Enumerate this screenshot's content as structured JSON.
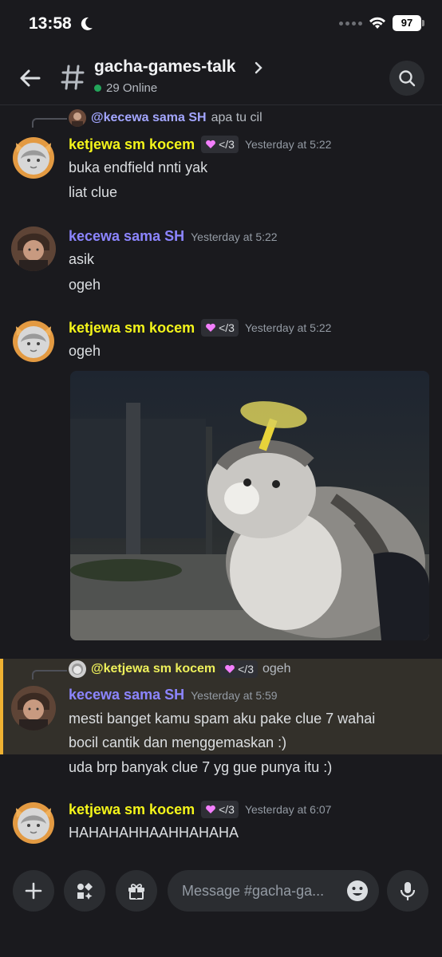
{
  "status_bar": {
    "time": "13:58",
    "battery": "97"
  },
  "header": {
    "channel_name": "gacha-games-talk",
    "online": "29 Online"
  },
  "messages": [
    {
      "reply": {
        "mention": "@kecewa sama SH",
        "text": "apa tu cil"
      },
      "author": "ketjewa sm kocem",
      "role": "</3",
      "time": "Yesterday at 5:22",
      "lines": [
        "buka endfield nnti yak",
        "liat clue"
      ]
    },
    {
      "author": "kecewa sama SH",
      "time": "Yesterday at 5:22",
      "lines": [
        "asik",
        "ogeh"
      ]
    },
    {
      "author": "ketjewa sm kocem",
      "role": "</3",
      "time": "Yesterday at 5:22",
      "lines": [
        "ogeh"
      ]
    },
    {
      "reply": {
        "mention": "@ketjewa sm kocem",
        "role": "</3",
        "text": "ogeh"
      },
      "author": "kecewa sama SH",
      "time": "Yesterday at 5:59",
      "lines": [
        "mesti banget kamu spam aku pake clue 7 wahai",
        "bocil cantik dan menggemaskan :)",
        "uda brp banyak clue 7 yg gue punya itu :)"
      ]
    },
    {
      "author": "ketjewa sm kocem",
      "role": "</3",
      "time": "Yesterday at 6:07",
      "lines": [
        "HAHAHAHHAAHHAHAHA"
      ]
    }
  ],
  "composer": {
    "placeholder": "Message #gacha-ga..."
  },
  "colors": {
    "accent_yellow": "#f4f51a",
    "accent_purple": "#8c85ff",
    "online_green": "#23a55a",
    "highlight_border": "#f0b232"
  }
}
